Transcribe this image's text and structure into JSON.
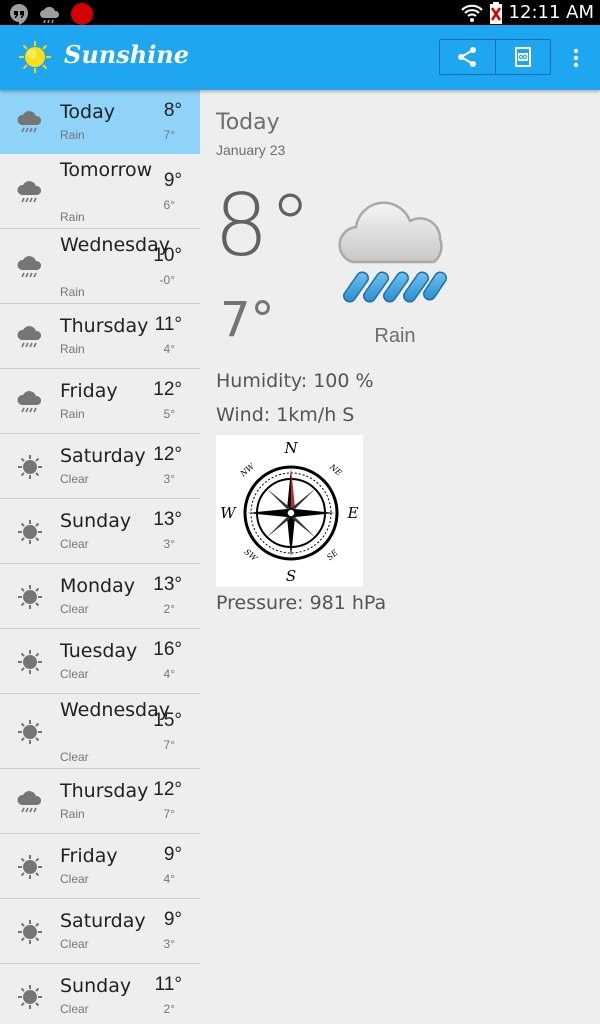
{
  "status_bar": {
    "time": "12:11 AM",
    "left_icons": [
      "hangouts-icon",
      "weather-notification-icon",
      "record-icon"
    ],
    "right_icons": [
      "wifi-icon",
      "battery-icon"
    ]
  },
  "action_bar": {
    "title": "Sunshine",
    "background": "#1ea6f0",
    "actions": [
      "share-icon",
      "cast-icon",
      "overflow-menu-icon"
    ]
  },
  "forecast": [
    {
      "day": "Today",
      "desc": "Rain",
      "high": "8°",
      "low": "7°",
      "icon": "rain-icon",
      "selected": true
    },
    {
      "day": "Tomorrow",
      "desc": "Rain",
      "high": "9°",
      "low": "6°",
      "icon": "rain-icon"
    },
    {
      "day": "Wednesday",
      "desc": "Rain",
      "high": "10°",
      "low": "-0°",
      "icon": "rain-icon"
    },
    {
      "day": "Thursday",
      "desc": "Rain",
      "high": "11°",
      "low": "4°",
      "icon": "rain-icon"
    },
    {
      "day": "Friday",
      "desc": "Rain",
      "high": "12°",
      "low": "5°",
      "icon": "rain-icon"
    },
    {
      "day": "Saturday",
      "desc": "Clear",
      "high": "12°",
      "low": "3°",
      "icon": "clear-icon"
    },
    {
      "day": "Sunday",
      "desc": "Clear",
      "high": "13°",
      "low": "3°",
      "icon": "clear-icon"
    },
    {
      "day": "Monday",
      "desc": "Clear",
      "high": "13°",
      "low": "2°",
      "icon": "clear-icon"
    },
    {
      "day": "Tuesday",
      "desc": "Clear",
      "high": "16°",
      "low": "4°",
      "icon": "clear-icon"
    },
    {
      "day": "Wednesday",
      "desc": "Clear",
      "high": "15°",
      "low": "7°",
      "icon": "clear-icon"
    },
    {
      "day": "Thursday",
      "desc": "Rain",
      "high": "12°",
      "low": "7°",
      "icon": "rain-icon"
    },
    {
      "day": "Friday",
      "desc": "Clear",
      "high": "9°",
      "low": "4°",
      "icon": "clear-icon"
    },
    {
      "day": "Saturday",
      "desc": "Clear",
      "high": "9°",
      "low": "3°",
      "icon": "clear-icon"
    },
    {
      "day": "Sunday",
      "desc": "Clear",
      "high": "11°",
      "low": "2°",
      "icon": "clear-icon"
    }
  ],
  "detail": {
    "day": "Today",
    "date": "January 23",
    "high": "8°",
    "low": "7°",
    "condition": "Rain",
    "humidity": "Humidity: 100 %",
    "wind": "Wind: 1km/h S",
    "pressure": "Pressure: 981 hPa",
    "compass_labels": {
      "n": "N",
      "s": "S",
      "e": "E",
      "w": "W",
      "nw": "NW",
      "ne": "NE",
      "sw": "SW",
      "se": "SE"
    }
  }
}
